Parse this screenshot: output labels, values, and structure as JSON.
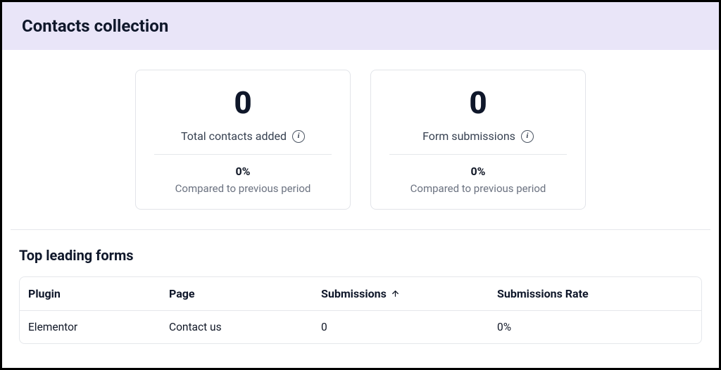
{
  "header": {
    "title": "Contacts collection"
  },
  "stats": {
    "contacts": {
      "value": "0",
      "label": "Total contacts added",
      "percent": "0%",
      "compare": "Compared to previous period"
    },
    "submissions": {
      "value": "0",
      "label": "Form submissions",
      "percent": "0%",
      "compare": "Compared to previous period"
    }
  },
  "leading_forms": {
    "title": "Top leading forms",
    "columns": {
      "plugin": "Plugin",
      "page": "Page",
      "submissions": "Submissions",
      "rate": "Submissions Rate"
    },
    "rows": [
      {
        "plugin": "Elementor",
        "page": "Contact us",
        "submissions": "0",
        "rate": "0%"
      }
    ]
  },
  "icons": {
    "info": "i"
  }
}
